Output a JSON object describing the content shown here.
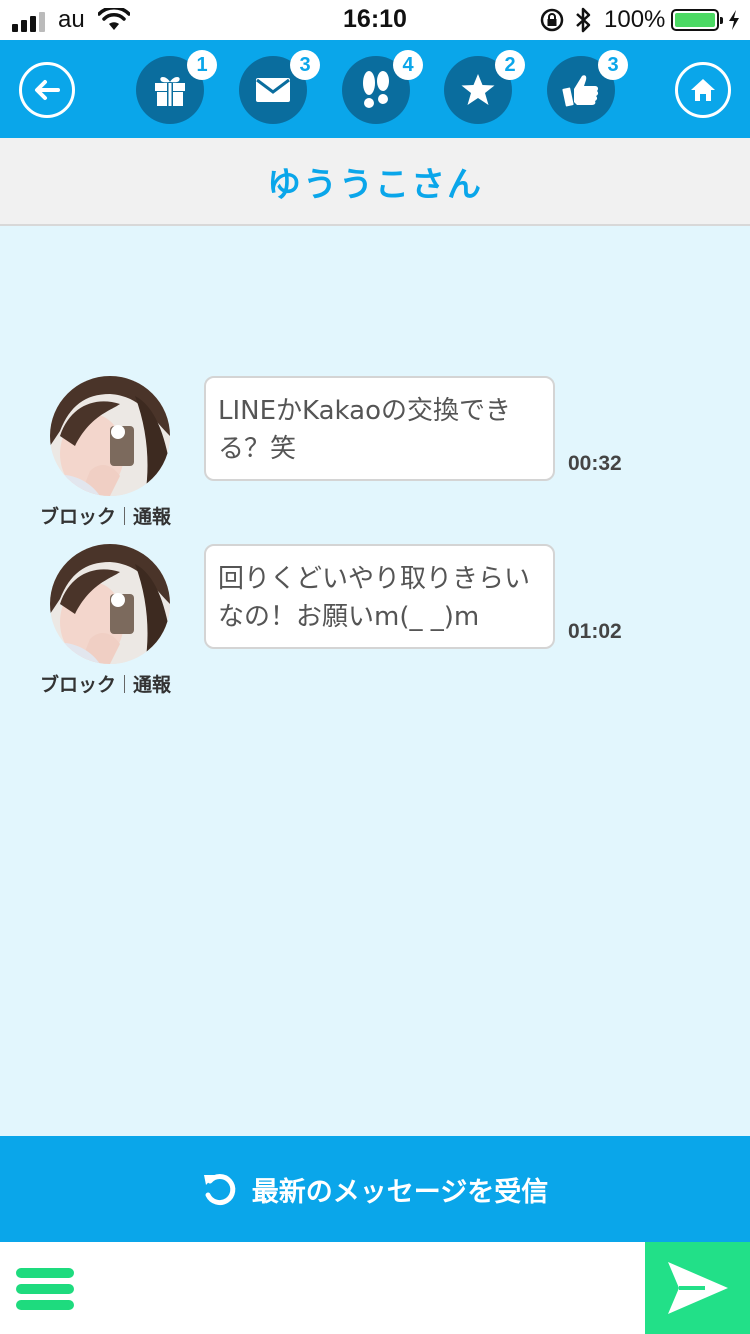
{
  "status_bar": {
    "carrier": "au",
    "time": "16:10",
    "battery_percent": "100%",
    "battery_level": 1.0
  },
  "nav": {
    "back_icon": "arrow-left-icon",
    "home_icon": "home-icon",
    "items": [
      {
        "icon": "gift-icon",
        "badge": "1"
      },
      {
        "icon": "mail-icon",
        "badge": "3"
      },
      {
        "icon": "footprints-icon",
        "badge": "4"
      },
      {
        "icon": "star-icon",
        "badge": "2"
      },
      {
        "icon": "thumbs-up-icon",
        "badge": "3"
      }
    ]
  },
  "conversation": {
    "partner_name": "ゆううこさん"
  },
  "messages": [
    {
      "text": "LINEかKakaoの交換できる？笑",
      "time": "00:32",
      "block_label": "ブロック",
      "report_label": "通報"
    },
    {
      "text": "回りくどいやり取りきらいなの！お願いm(_ _)m",
      "time": "01:02",
      "block_label": "ブロック",
      "report_label": "通報"
    }
  ],
  "receive_button": {
    "label": "最新のメッセージを受信",
    "icon": "refresh-icon"
  },
  "composer": {
    "placeholder": "",
    "menu_icon": "menu-icon",
    "send_icon": "send-icon"
  },
  "colors": {
    "primary": "#0aa6ea",
    "nav_icon_bg": "#0a6d9e",
    "chat_background": "#e2f6fd",
    "send_button": "#22e088"
  }
}
